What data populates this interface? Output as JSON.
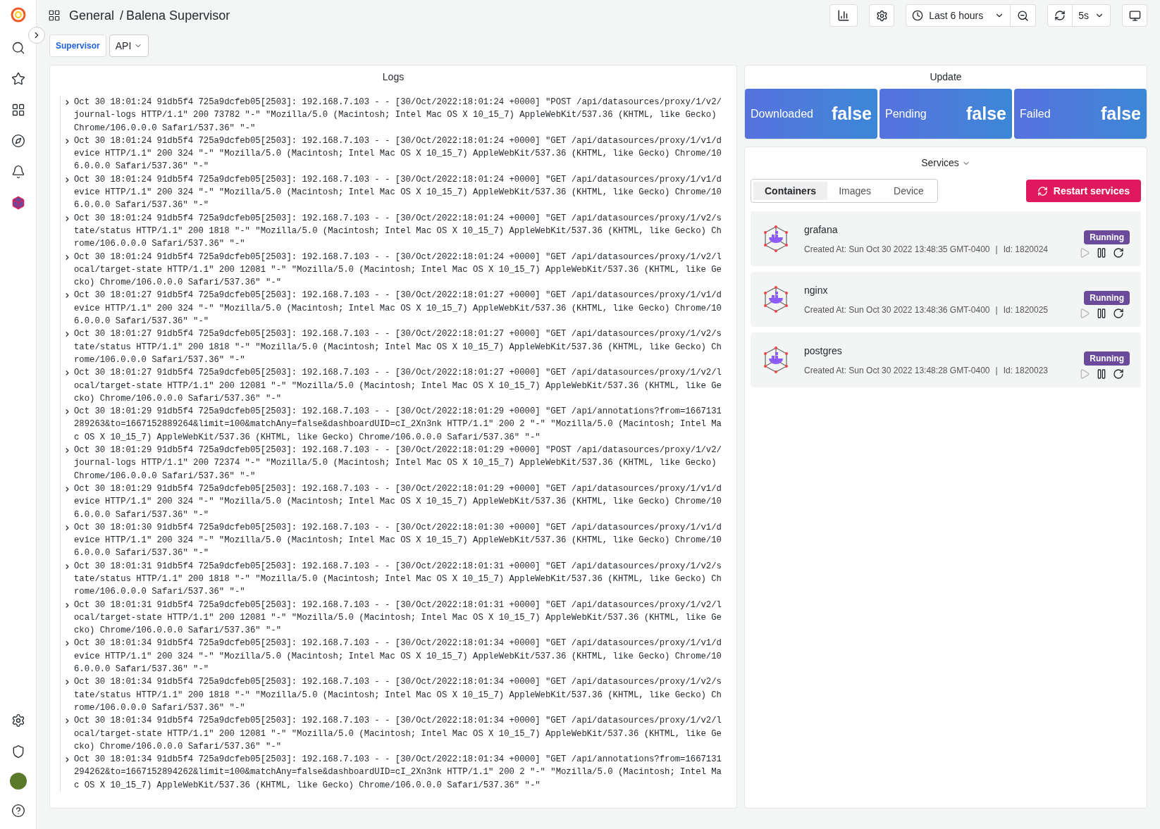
{
  "header": {
    "folder": "General",
    "separator": "/",
    "title": "Balena Supervisor"
  },
  "toolbar": {
    "time_range": "Last 6 hours",
    "refresh_interval": "5s"
  },
  "variables": [
    {
      "label": "Supervisor",
      "value": "API"
    }
  ],
  "logs": {
    "title": "Logs",
    "entries": [
      "Oct 30 18:01:24 91db5f4 725a9dcfeb05[2503]: 192.168.7.103 - - [30/Oct/2022:18:01:24 +0000] \"POST /api/datasources/proxy/1/v2/journal-logs HTTP/1.1\" 200 73782 \"-\" \"Mozilla/5.0 (Macintosh; Intel Mac OS X 10_15_7) AppleWebKit/537.36 (KHTML, like Gecko) Chrome/106.0.0.0 Safari/537.36\" \"-\"",
      "Oct 30 18:01:24 91db5f4 725a9dcfeb05[2503]: 192.168.7.103 - - [30/Oct/2022:18:01:24 +0000] \"GET /api/datasources/proxy/1/v1/device HTTP/1.1\" 200 324 \"-\" \"Mozilla/5.0 (Macintosh; Intel Mac OS X 10_15_7) AppleWebKit/537.36 (KHTML, like Gecko) Chrome/106.0.0.0 Safari/537.36\" \"-\"",
      "Oct 30 18:01:24 91db5f4 725a9dcfeb05[2503]: 192.168.7.103 - - [30/Oct/2022:18:01:24 +0000] \"GET /api/datasources/proxy/1/v1/device HTTP/1.1\" 200 324 \"-\" \"Mozilla/5.0 (Macintosh; Intel Mac OS X 10_15_7) AppleWebKit/537.36 (KHTML, like Gecko) Chrome/106.0.0.0 Safari/537.36\" \"-\"",
      "Oct 30 18:01:24 91db5f4 725a9dcfeb05[2503]: 192.168.7.103 - - [30/Oct/2022:18:01:24 +0000] \"GET /api/datasources/proxy/1/v2/state/status HTTP/1.1\" 200 1818 \"-\" \"Mozilla/5.0 (Macintosh; Intel Mac OS X 10_15_7) AppleWebKit/537.36 (KHTML, like Gecko) Chrome/106.0.0.0 Safari/537.36\" \"-\"",
      "Oct 30 18:01:24 91db5f4 725a9dcfeb05[2503]: 192.168.7.103 - - [30/Oct/2022:18:01:24 +0000] \"GET /api/datasources/proxy/1/v2/local/target-state HTTP/1.1\" 200 12081 \"-\" \"Mozilla/5.0 (Macintosh; Intel Mac OS X 10_15_7) AppleWebKit/537.36 (KHTML, like Gecko) Chrome/106.0.0.0 Safari/537.36\" \"-\"",
      "Oct 30 18:01:27 91db5f4 725a9dcfeb05[2503]: 192.168.7.103 - - [30/Oct/2022:18:01:27 +0000] \"GET /api/datasources/proxy/1/v1/device HTTP/1.1\" 200 324 \"-\" \"Mozilla/5.0 (Macintosh; Intel Mac OS X 10_15_7) AppleWebKit/537.36 (KHTML, like Gecko) Chrome/106.0.0.0 Safari/537.36\" \"-\"",
      "Oct 30 18:01:27 91db5f4 725a9dcfeb05[2503]: 192.168.7.103 - - [30/Oct/2022:18:01:27 +0000] \"GET /api/datasources/proxy/1/v2/state/status HTTP/1.1\" 200 1818 \"-\" \"Mozilla/5.0 (Macintosh; Intel Mac OS X 10_15_7) AppleWebKit/537.36 (KHTML, like Gecko) Chrome/106.0.0.0 Safari/537.36\" \"-\"",
      "Oct 30 18:01:27 91db5f4 725a9dcfeb05[2503]: 192.168.7.103 - - [30/Oct/2022:18:01:27 +0000] \"GET /api/datasources/proxy/1/v2/local/target-state HTTP/1.1\" 200 12081 \"-\" \"Mozilla/5.0 (Macintosh; Intel Mac OS X 10_15_7) AppleWebKit/537.36 (KHTML, like Gecko) Chrome/106.0.0.0 Safari/537.36\" \"-\"",
      "Oct 30 18:01:29 91db5f4 725a9dcfeb05[2503]: 192.168.7.103 - - [30/Oct/2022:18:01:29 +0000] \"GET /api/annotations?from=1667131289263&to=1667152889264&limit=100&matchAny=false&dashboardUID=cI_2Xn3nk HTTP/1.1\" 200 2 \"-\" \"Mozilla/5.0 (Macintosh; Intel Mac OS X 10_15_7) AppleWebKit/537.36 (KHTML, like Gecko) Chrome/106.0.0.0 Safari/537.36\" \"-\"",
      "Oct 30 18:01:29 91db5f4 725a9dcfeb05[2503]: 192.168.7.103 - - [30/Oct/2022:18:01:29 +0000] \"POST /api/datasources/proxy/1/v2/journal-logs HTTP/1.1\" 200 72374 \"-\" \"Mozilla/5.0 (Macintosh; Intel Mac OS X 10_15_7) AppleWebKit/537.36 (KHTML, like Gecko) Chrome/106.0.0.0 Safari/537.36\" \"-\"",
      "Oct 30 18:01:29 91db5f4 725a9dcfeb05[2503]: 192.168.7.103 - - [30/Oct/2022:18:01:29 +0000] \"GET /api/datasources/proxy/1/v1/device HTTP/1.1\" 200 324 \"-\" \"Mozilla/5.0 (Macintosh; Intel Mac OS X 10_15_7) AppleWebKit/537.36 (KHTML, like Gecko) Chrome/106.0.0.0 Safari/537.36\" \"-\"",
      "Oct 30 18:01:30 91db5f4 725a9dcfeb05[2503]: 192.168.7.103 - - [30/Oct/2022:18:01:30 +0000] \"GET /api/datasources/proxy/1/v1/device HTTP/1.1\" 200 324 \"-\" \"Mozilla/5.0 (Macintosh; Intel Mac OS X 10_15_7) AppleWebKit/537.36 (KHTML, like Gecko) Chrome/106.0.0.0 Safari/537.36\" \"-\"",
      "Oct 30 18:01:31 91db5f4 725a9dcfeb05[2503]: 192.168.7.103 - - [30/Oct/2022:18:01:31 +0000] \"GET /api/datasources/proxy/1/v2/state/status HTTP/1.1\" 200 1818 \"-\" \"Mozilla/5.0 (Macintosh; Intel Mac OS X 10_15_7) AppleWebKit/537.36 (KHTML, like Gecko) Chrome/106.0.0.0 Safari/537.36\" \"-\"",
      "Oct 30 18:01:31 91db5f4 725a9dcfeb05[2503]: 192.168.7.103 - - [30/Oct/2022:18:01:31 +0000] \"GET /api/datasources/proxy/1/v2/local/target-state HTTP/1.1\" 200 12081 \"-\" \"Mozilla/5.0 (Macintosh; Intel Mac OS X 10_15_7) AppleWebKit/537.36 (KHTML, like Gecko) Chrome/106.0.0.0 Safari/537.36\" \"-\"",
      "Oct 30 18:01:34 91db5f4 725a9dcfeb05[2503]: 192.168.7.103 - - [30/Oct/2022:18:01:34 +0000] \"GET /api/datasources/proxy/1/v1/device HTTP/1.1\" 200 324 \"-\" \"Mozilla/5.0 (Macintosh; Intel Mac OS X 10_15_7) AppleWebKit/537.36 (KHTML, like Gecko) Chrome/106.0.0.0 Safari/537.36\" \"-\"",
      "Oct 30 18:01:34 91db5f4 725a9dcfeb05[2503]: 192.168.7.103 - - [30/Oct/2022:18:01:34 +0000] \"GET /api/datasources/proxy/1/v2/state/status HTTP/1.1\" 200 1818 \"-\" \"Mozilla/5.0 (Macintosh; Intel Mac OS X 10_15_7) AppleWebKit/537.36 (KHTML, like Gecko) Chrome/106.0.0.0 Safari/537.36\" \"-\"",
      "Oct 30 18:01:34 91db5f4 725a9dcfeb05[2503]: 192.168.7.103 - - [30/Oct/2022:18:01:34 +0000] \"GET /api/datasources/proxy/1/v2/local/target-state HTTP/1.1\" 200 12081 \"-\" \"Mozilla/5.0 (Macintosh; Intel Mac OS X 10_15_7) AppleWebKit/537.36 (KHTML, like Gecko) Chrome/106.0.0.0 Safari/537.36\" \"-\"",
      "Oct 30 18:01:34 91db5f4 725a9dcfeb05[2503]: 192.168.7.103 - - [30/Oct/2022:18:01:34 +0000] \"GET /api/annotations?from=1667131294262&to=1667152894262&limit=100&matchAny=false&dashboardUID=cI_2Xn3nk HTTP/1.1\" 200 2 \"-\" \"Mozilla/5.0 (Macintosh; Intel Mac OS X 10_15_7) AppleWebKit/537.36 (KHTML, like Gecko) Chrome/106.0.0.0 Safari/537.36\" \"-\""
    ]
  },
  "update": {
    "title": "Update",
    "stats": [
      {
        "label": "Downloaded",
        "value": "false"
      },
      {
        "label": "Pending",
        "value": "false"
      },
      {
        "label": "Failed",
        "value": "false"
      }
    ]
  },
  "services": {
    "title": "Services",
    "separator": "|",
    "restart_button": "Restart services",
    "tabs": [
      {
        "label": "Containers",
        "selected": true
      },
      {
        "label": "Images",
        "selected": false
      },
      {
        "label": "Device",
        "selected": false
      }
    ],
    "items": [
      {
        "name": "grafana",
        "created": "Created At: Sun Oct 30 2022 13:48:35 GMT-0400",
        "id": "Id: 1820024",
        "status": "Running"
      },
      {
        "name": "nginx",
        "created": "Created At: Sun Oct 30 2022 13:48:36 GMT-0400",
        "id": "Id: 1820025",
        "status": "Running"
      },
      {
        "name": "postgres",
        "created": "Created At: Sun Oct 30 2022 13:48:28 GMT-0400",
        "id": "Id: 1820023",
        "status": "Running"
      }
    ]
  }
}
